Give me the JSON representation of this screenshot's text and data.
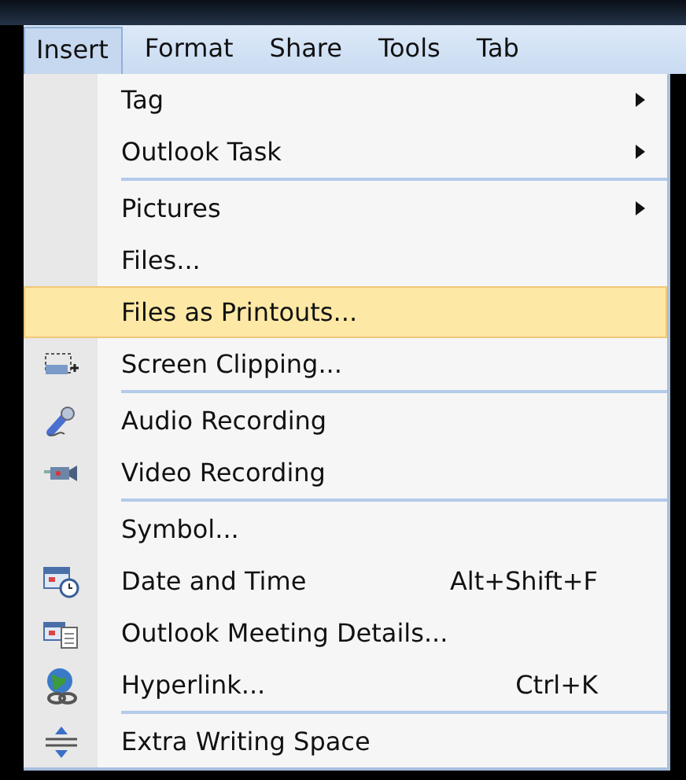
{
  "menubar": [
    {
      "label": "Insert",
      "selected": true
    },
    {
      "label": "Format",
      "selected": false
    },
    {
      "label": "Share",
      "selected": false
    },
    {
      "label": "Tools",
      "selected": false
    },
    {
      "label": "Tab",
      "selected": false
    }
  ],
  "menu": {
    "items": [
      {
        "kind": "item",
        "label": "Tag",
        "submenu": true,
        "selected": false
      },
      {
        "kind": "item",
        "label": "Outlook Task",
        "submenu": true,
        "selected": false
      },
      {
        "kind": "separator"
      },
      {
        "kind": "item",
        "label": "Pictures",
        "submenu": true,
        "selected": false
      },
      {
        "kind": "item",
        "label": "Files...",
        "submenu": false,
        "selected": false
      },
      {
        "kind": "item",
        "label": "Files as Printouts...",
        "submenu": false,
        "selected": true
      },
      {
        "kind": "item",
        "label": "Screen Clipping...",
        "submenu": false,
        "selected": false
      },
      {
        "kind": "separator"
      },
      {
        "kind": "item",
        "label": "Audio Recording",
        "submenu": false,
        "selected": false
      },
      {
        "kind": "item",
        "label": "Video Recording",
        "submenu": false,
        "selected": false
      },
      {
        "kind": "separator"
      },
      {
        "kind": "item",
        "label": "Symbol...",
        "submenu": false,
        "selected": false
      },
      {
        "kind": "item",
        "label": "Date and Time",
        "shortcut": "Alt+Shift+F",
        "submenu": false,
        "selected": false
      },
      {
        "kind": "item",
        "label": "Outlook Meeting Details...",
        "submenu": false,
        "selected": false
      },
      {
        "kind": "item",
        "label": "Hyperlink...",
        "shortcut": "Ctrl+K",
        "submenu": false,
        "selected": false
      },
      {
        "kind": "separator"
      },
      {
        "kind": "item",
        "label": "Extra Writing Space",
        "submenu": false,
        "selected": false
      }
    ]
  }
}
